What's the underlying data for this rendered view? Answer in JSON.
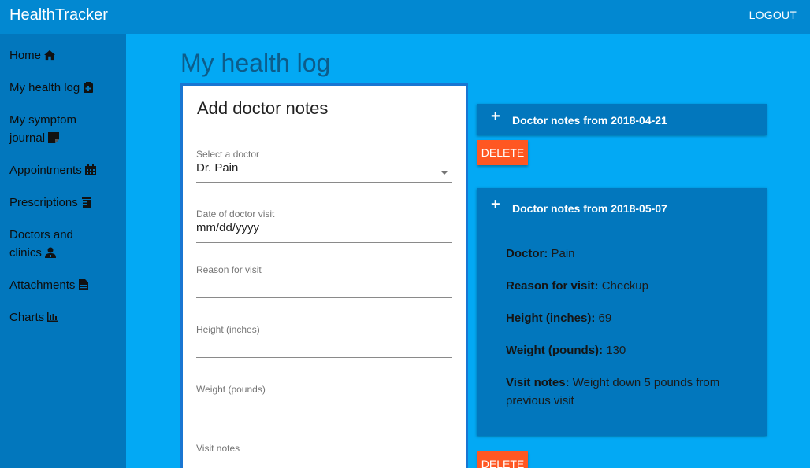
{
  "app": {
    "title": "HealthTracker",
    "logout_label": "LOGOUT"
  },
  "sidebar": {
    "items": [
      {
        "label": "Home",
        "icon": "home-icon"
      },
      {
        "label": "My health log",
        "icon": "clipboard-plus-icon"
      },
      {
        "label": "My symptom journal",
        "icon": "sticky-note-icon"
      },
      {
        "label": "Appointments",
        "icon": "calendar-icon"
      },
      {
        "label": "Prescriptions",
        "icon": "prescription-bottle-icon"
      },
      {
        "label": "Doctors and clinics",
        "icon": "user-doctor-icon"
      },
      {
        "label": "Attachments",
        "icon": "file-icon"
      },
      {
        "label": "Charts",
        "icon": "chart-bar-icon"
      }
    ]
  },
  "page": {
    "title": "My health log"
  },
  "form": {
    "title": "Add doctor notes",
    "doctor": {
      "label": "Select a doctor",
      "value": "Dr. Pain"
    },
    "visit_date": {
      "label": "Date of doctor visit",
      "value": "mm/dd/yyyy"
    },
    "reason": {
      "label": "Reason for visit",
      "value": ""
    },
    "height": {
      "label": "Height (inches)",
      "value": ""
    },
    "weight": {
      "label": "Weight (pounds)",
      "value": ""
    },
    "notes": {
      "label": "Visit notes",
      "value": ""
    }
  },
  "notes": [
    {
      "title": "Doctor notes from 2018-04-21",
      "expanded": false,
      "delete_label": "DELETE"
    },
    {
      "title": "Doctor notes from 2018-05-07",
      "expanded": true,
      "delete_label": "DELETE",
      "details": [
        {
          "label": "Doctor:",
          "value": "Pain"
        },
        {
          "label": "Reason for visit:",
          "value": "Checkup"
        },
        {
          "label": "Height (inches):",
          "value": "69"
        },
        {
          "label": "Weight (pounds):",
          "value": "130"
        },
        {
          "label": "Visit notes:",
          "value": "Weight down 5 pounds from previous visit"
        }
      ]
    }
  ],
  "colors": {
    "topbar": "#0288d1",
    "sidebar": "#0277bd",
    "content": "#03a9f4",
    "delete": "#ff5722",
    "form_border": "#1976d2"
  }
}
